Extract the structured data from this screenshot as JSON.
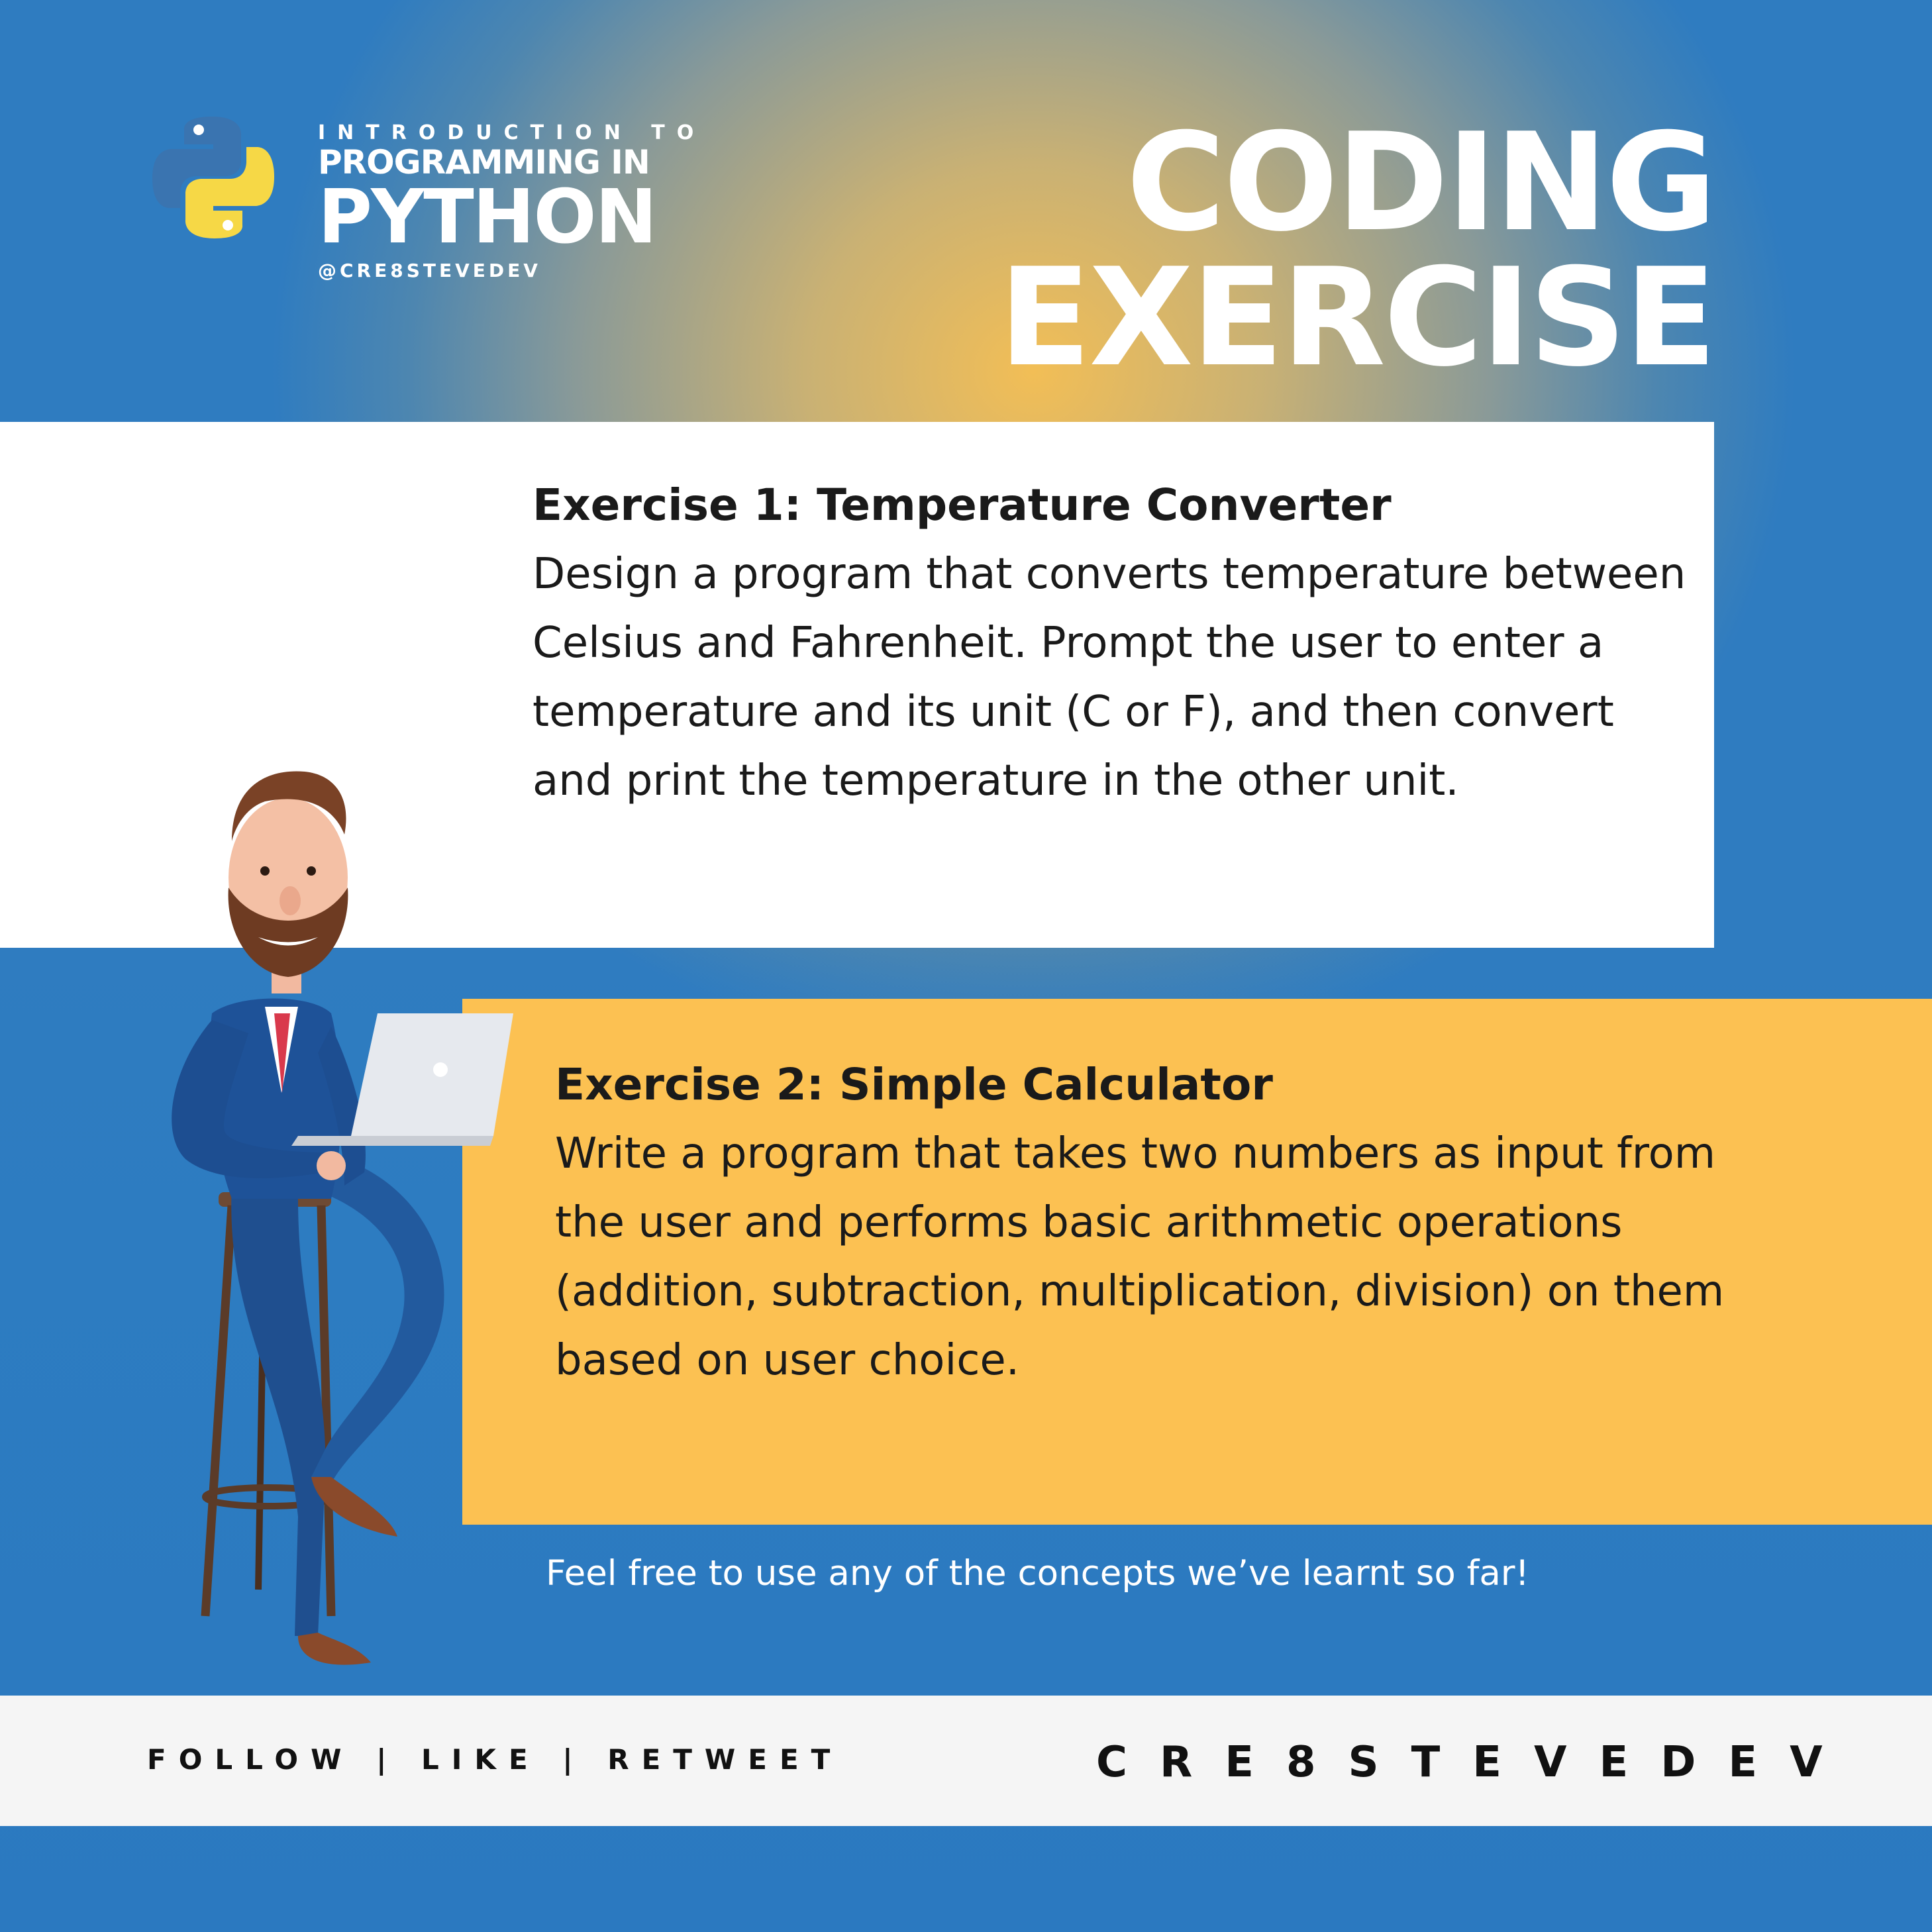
{
  "brand": {
    "intro": "INTRODUCTION TO",
    "line1": "PROGRAMMING IN",
    "line2": "PYTHON",
    "handle": "@CRE8STEVEDEV",
    "logo_icon": "python-logo-icon",
    "colors": {
      "python_blue": "#3a74b0",
      "python_yellow": "#f6d846"
    }
  },
  "title": {
    "line1": "CODING",
    "line2": "EXERCISE"
  },
  "exercises": [
    {
      "heading": "Exercise 1: Temperature Converter",
      "body": "Design a program that converts temperature between Celsius and Fahrenheit. Prompt the user to enter a temperature and its unit (C or F), and then convert and print the temperature in the other unit."
    },
    {
      "heading": "Exercise 2: Simple Calculator",
      "body": "Write a program that takes two numbers as input from the user and performs basic arithmetic operations (addition, subtraction, multiplication, division) on them based on user choice."
    }
  ],
  "note": "Feel free to use any of the concepts we’ve learnt so far!",
  "footer": {
    "left": "FOLLOW | LIKE | RETWEET",
    "right": "CRE8STEVEDEV"
  },
  "colors": {
    "blue": "#2d7cc1",
    "gold": "#f2be56",
    "card_yellow": "#fcc152",
    "footer_bg": "#f5f5f5"
  }
}
